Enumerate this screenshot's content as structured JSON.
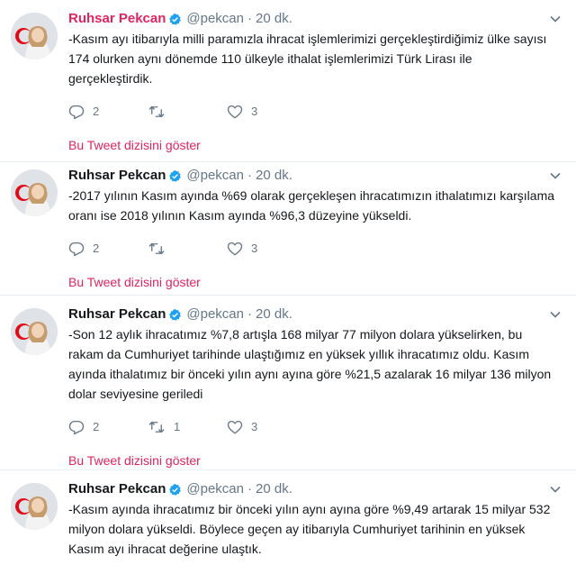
{
  "tweets": [
    {
      "name": "Ruhsar Pekcan",
      "handle": "@pekcan",
      "separator": "·",
      "time": "20 dk.",
      "text": "-Kasım ayı itibarıyla milli paramızla ihracat işlemlerimizi gerçekleştirdiğimiz ülke sayısı 174 olurken aynı dönemde 110 ülkeyle ithalat işlemlerimizi Türk Lirası ile gerçekleştirdik.",
      "replies": "2",
      "retweets": "",
      "likes": "3",
      "thread_link": "Bu Tweet dizisini göster",
      "name_highlighted": true
    },
    {
      "name": "Ruhsar Pekcan",
      "handle": "@pekcan",
      "separator": "·",
      "time": "20 dk.",
      "text": "-2017 yılının Kasım ayında %69 olarak gerçekleşen ihracatımızın ithalatımızı karşılama oranı ise 2018 yılının Kasım ayında %96,3 düzeyine yükseldi.",
      "replies": "2",
      "retweets": "",
      "likes": "3",
      "thread_link": "Bu Tweet dizisini göster",
      "name_highlighted": false
    },
    {
      "name": "Ruhsar Pekcan",
      "handle": "@pekcan",
      "separator": "·",
      "time": "20 dk.",
      "text": "-Son 12 aylık ihracatımız %7,8 artışla 168 milyar 77 milyon dolara yükselirken, bu rakam da Cumhuriyet tarihinde ulaştığımız en yüksek yıllık ihracatımız oldu. Kasım ayında ithalatımız bir önceki yılın aynı ayına göre %21,5 azalarak 16 milyar 136 milyon dolar seviyesine geriledi",
      "replies": "2",
      "retweets": "1",
      "likes": "3",
      "thread_link": "Bu Tweet dizisini göster",
      "name_highlighted": false
    },
    {
      "name": "Ruhsar Pekcan",
      "handle": "@pekcan",
      "separator": "·",
      "time": "20 dk.",
      "text": "-Kasım ayında ihracatımız bir önceki yılın aynı ayına göre %9,49 artarak 15 milyar 532 milyon dolara yükseldi. Böylece geçen ay itibarıyla Cumhuriyet tarihinin en yüksek Kasım ayı ihracat değerine ulaştık.",
      "name_highlighted": false
    }
  ],
  "colors": {
    "accent": "#e0245e",
    "verified": "#1da1f2",
    "muted": "#657786",
    "text": "#14171a",
    "divider": "#e6ecf0"
  },
  "icons": {
    "verified": "verified-badge-icon",
    "reply": "reply-icon",
    "retweet": "retweet-icon",
    "like": "heart-icon",
    "menu": "chevron-down-icon"
  }
}
